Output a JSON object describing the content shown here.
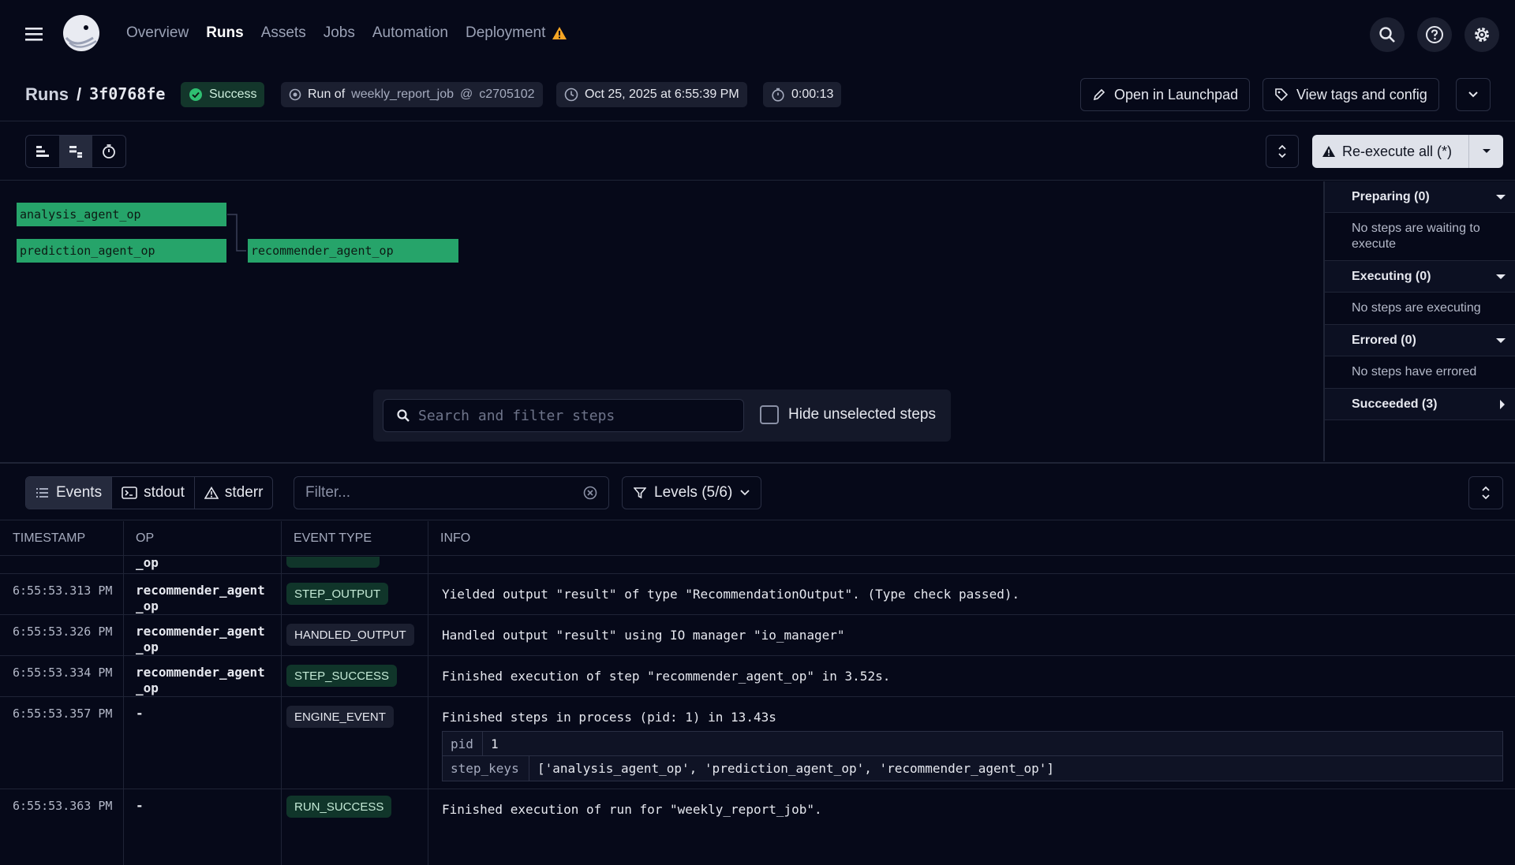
{
  "nav": {
    "links": [
      "Overview",
      "Runs",
      "Assets",
      "Jobs",
      "Automation",
      "Deployment"
    ],
    "active": "Runs"
  },
  "run": {
    "breadcrumb_root": "Runs",
    "separator": "/",
    "run_id": "3f0768fe",
    "status": "Success",
    "run_of_label": "Run of",
    "job_name": "weekly_report_job",
    "job_at": "@",
    "commit": "c2705102",
    "started": "Oct 25, 2025 at 6:55:39 PM",
    "duration": "0:00:13",
    "open_launchpad": "Open in Launchpad",
    "view_tags": "View tags and config"
  },
  "toolbar": {
    "reexecute_label": "Re-execute all (*)"
  },
  "gantt": {
    "steps": [
      "analysis_agent_op",
      "prediction_agent_op",
      "recommender_agent_op"
    ],
    "search_placeholder": "Search and filter steps",
    "hide_unselected": "Hide unselected steps"
  },
  "sidepanel": {
    "sections": [
      {
        "title": "Preparing (0)",
        "body": "No steps are waiting to execute"
      },
      {
        "title": "Executing (0)",
        "body": "No steps are executing"
      },
      {
        "title": "Errored (0)",
        "body": "No steps have errored"
      },
      {
        "title": "Succeeded (3)",
        "body": ""
      }
    ]
  },
  "logs": {
    "tabs": [
      "Events",
      "stdout",
      "stderr"
    ],
    "filter_placeholder": "Filter...",
    "levels": "Levels (5/6)",
    "headers": [
      "TIMESTAMP",
      "OP",
      "EVENT TYPE",
      "INFO"
    ],
    "partial_op": "_op",
    "rows": [
      {
        "ts": "6:55:53.313 PM",
        "op1": "recommender_agent",
        "op2": "_op",
        "type": "STEP_OUTPUT",
        "info": "Yielded output \"result\" of type \"RecommendationOutput\". (Type check passed)."
      },
      {
        "ts": "6:55:53.326 PM",
        "op1": "recommender_agent",
        "op2": "_op",
        "type": "HANDLED_OUTPUT",
        "info": "Handled output \"result\" using IO manager \"io_manager\""
      },
      {
        "ts": "6:55:53.334 PM",
        "op1": "recommender_agent",
        "op2": "_op",
        "type": "STEP_SUCCESS",
        "info": "Finished execution of step \"recommender_agent_op\" in 3.52s."
      },
      {
        "ts": "6:55:53.357 PM",
        "op1": "-",
        "op2": "",
        "type": "ENGINE_EVENT",
        "info": "Finished steps in process (pid: 1) in 13.43s"
      },
      {
        "ts": "6:55:53.363 PM",
        "op1": "-",
        "op2": "",
        "type": "RUN_SUCCESS",
        "info": "Finished execution of run for \"weekly_report_job\"."
      }
    ],
    "engine_kv": [
      {
        "key": "pid",
        "value": "1"
      },
      {
        "key": "step_keys",
        "value": "['analysis_agent_op', 'prediction_agent_op', 'recommender_agent_op']"
      }
    ]
  },
  "colors": {
    "background": "#060919",
    "step_success": "#26a46a",
    "warning": "#f5a524",
    "success_badge": "#13362b"
  }
}
